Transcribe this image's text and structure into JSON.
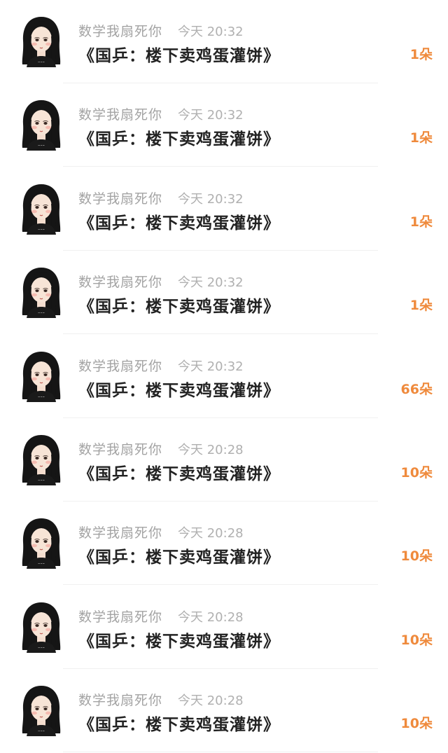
{
  "colors": {
    "accent": "#ef8a3c",
    "username": "#a3a3a3",
    "time": "#b0b0b0",
    "title": "#222222"
  },
  "avatar_icon": "cartoon-girl-avatar-icon",
  "rows": [
    {
      "username": "数学我扇死你",
      "time": "今天 20:32",
      "title": "《国乒：楼下卖鸡蛋灌饼》",
      "count": "1朵"
    },
    {
      "username": "数学我扇死你",
      "time": "今天 20:32",
      "title": "《国乒：楼下卖鸡蛋灌饼》",
      "count": "1朵"
    },
    {
      "username": "数学我扇死你",
      "time": "今天 20:32",
      "title": "《国乒：楼下卖鸡蛋灌饼》",
      "count": "1朵"
    },
    {
      "username": "数学我扇死你",
      "time": "今天 20:32",
      "title": "《国乒：楼下卖鸡蛋灌饼》",
      "count": "1朵"
    },
    {
      "username": "数学我扇死你",
      "time": "今天 20:32",
      "title": "《国乒：楼下卖鸡蛋灌饼》",
      "count": "66朵"
    },
    {
      "username": "数学我扇死你",
      "time": "今天 20:28",
      "title": "《国乒：楼下卖鸡蛋灌饼》",
      "count": "10朵"
    },
    {
      "username": "数学我扇死你",
      "time": "今天 20:28",
      "title": "《国乒：楼下卖鸡蛋灌饼》",
      "count": "10朵"
    },
    {
      "username": "数学我扇死你",
      "time": "今天 20:28",
      "title": "《国乒：楼下卖鸡蛋灌饼》",
      "count": "10朵"
    },
    {
      "username": "数学我扇死你",
      "time": "今天 20:28",
      "title": "《国乒：楼下卖鸡蛋灌饼》",
      "count": "10朵"
    }
  ]
}
